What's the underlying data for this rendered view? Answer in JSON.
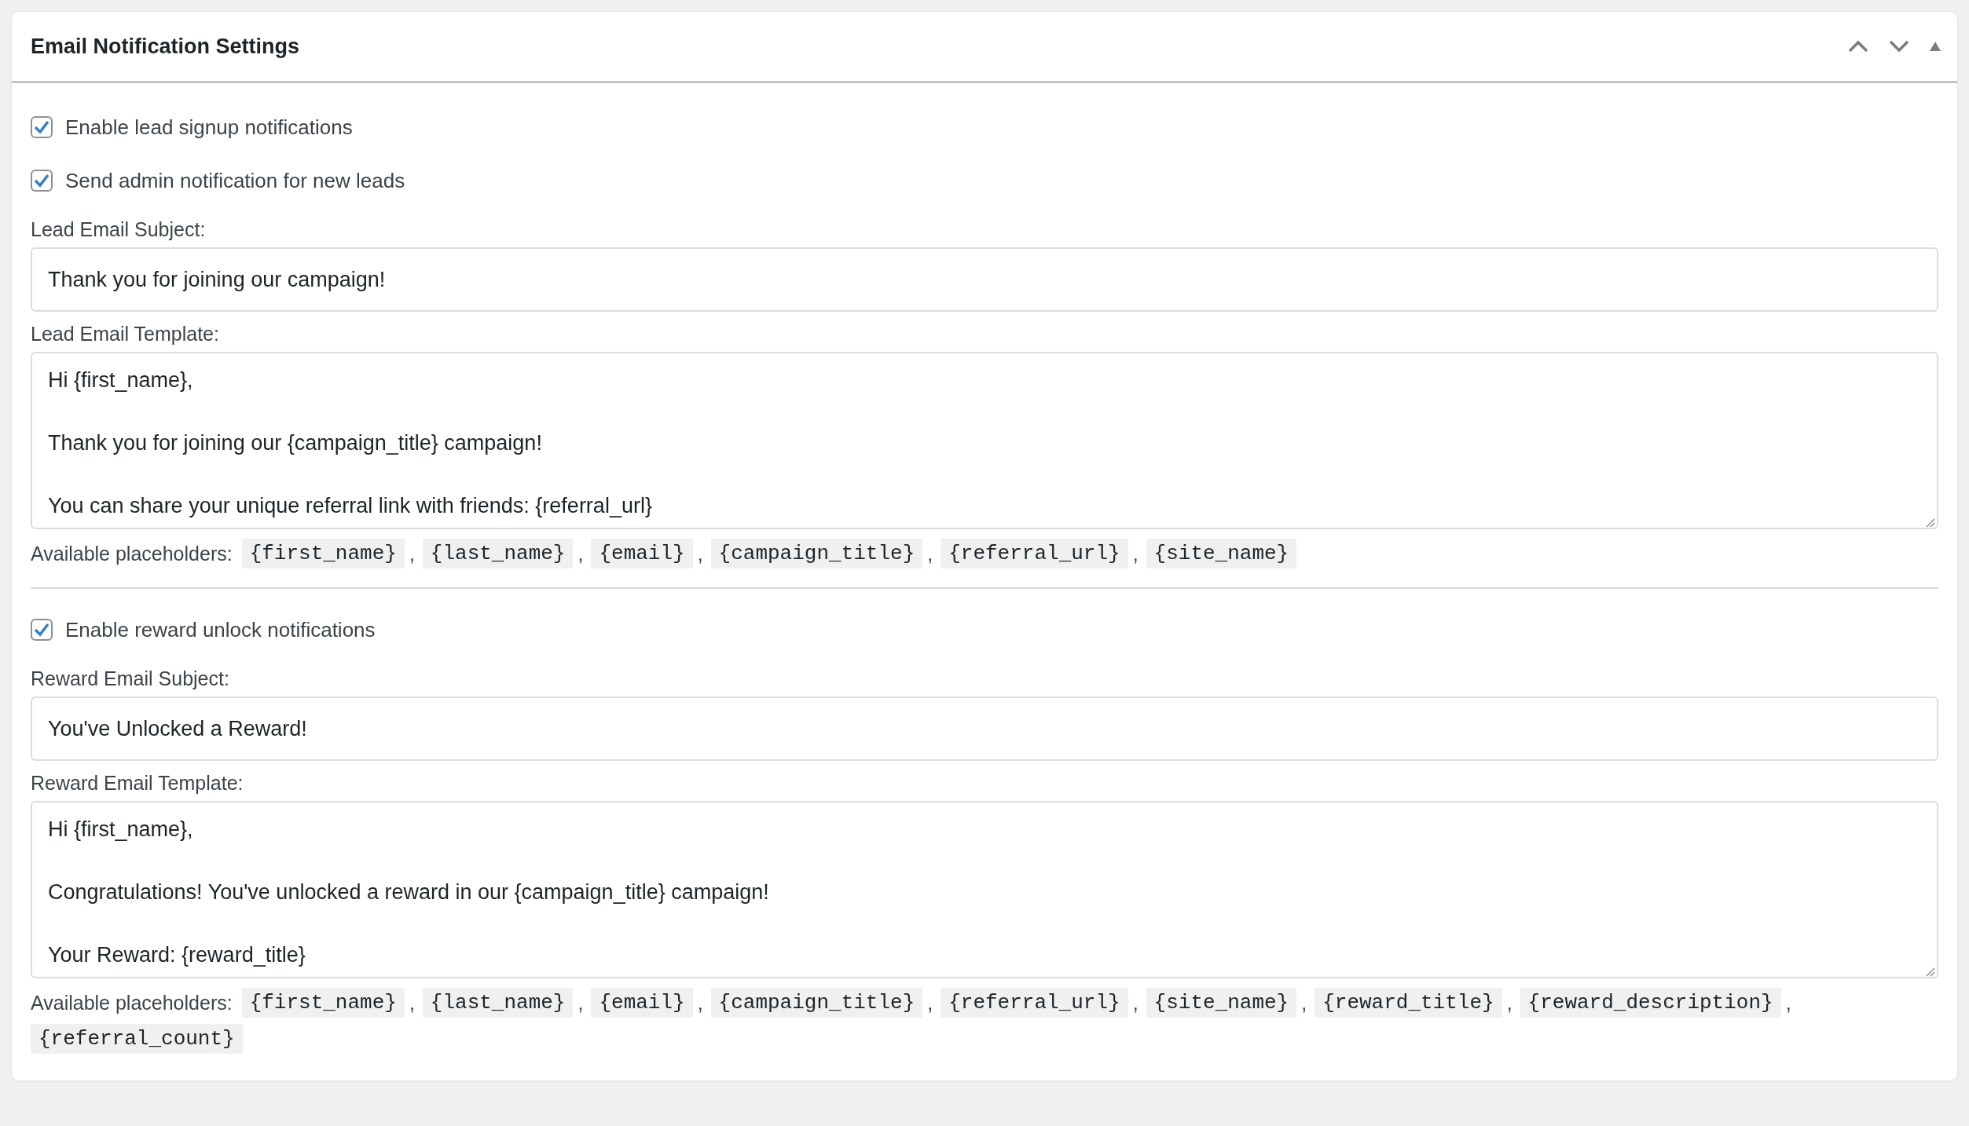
{
  "panel": {
    "title": "Email Notification Settings"
  },
  "sections": [
    {
      "checkboxes": [
        {
          "label": "Enable lead signup notifications",
          "checked": true
        },
        {
          "label": "Send admin notification for new leads",
          "checked": true
        }
      ],
      "fields": [
        {
          "kind": "input",
          "label": "Lead Email Subject:",
          "value": "Thank you for joining our campaign!"
        },
        {
          "kind": "textarea",
          "label": "Lead Email Template:",
          "value": "Hi {first_name},\n\nThank you for joining our {campaign_title} campaign!\n\nYou can share your unique referral link with friends: {referral_url}"
        }
      ],
      "placeholders": {
        "label": "Available placeholders:",
        "separator": ",",
        "items": [
          "{first_name}",
          "{last_name}",
          "{email}",
          "{campaign_title}",
          "{referral_url}",
          "{site_name}"
        ]
      }
    },
    {
      "checkboxes": [
        {
          "label": "Enable reward unlock notifications",
          "checked": true
        }
      ],
      "fields": [
        {
          "kind": "input",
          "label": "Reward Email Subject:",
          "value": "You've Unlocked a Reward!"
        },
        {
          "kind": "textarea",
          "label": "Reward Email Template:",
          "value": "Hi {first_name},\n\nCongratulations! You've unlocked a reward in our {campaign_title} campaign!\n\nYour Reward: {reward_title}"
        }
      ],
      "placeholders": {
        "label": "Available placeholders:",
        "separator": ",",
        "items": [
          "{first_name}",
          "{last_name}",
          "{email}",
          "{campaign_title}",
          "{referral_url}",
          "{site_name}",
          "{reward_title}",
          "{reward_description}",
          "{referral_count}"
        ]
      }
    }
  ]
}
